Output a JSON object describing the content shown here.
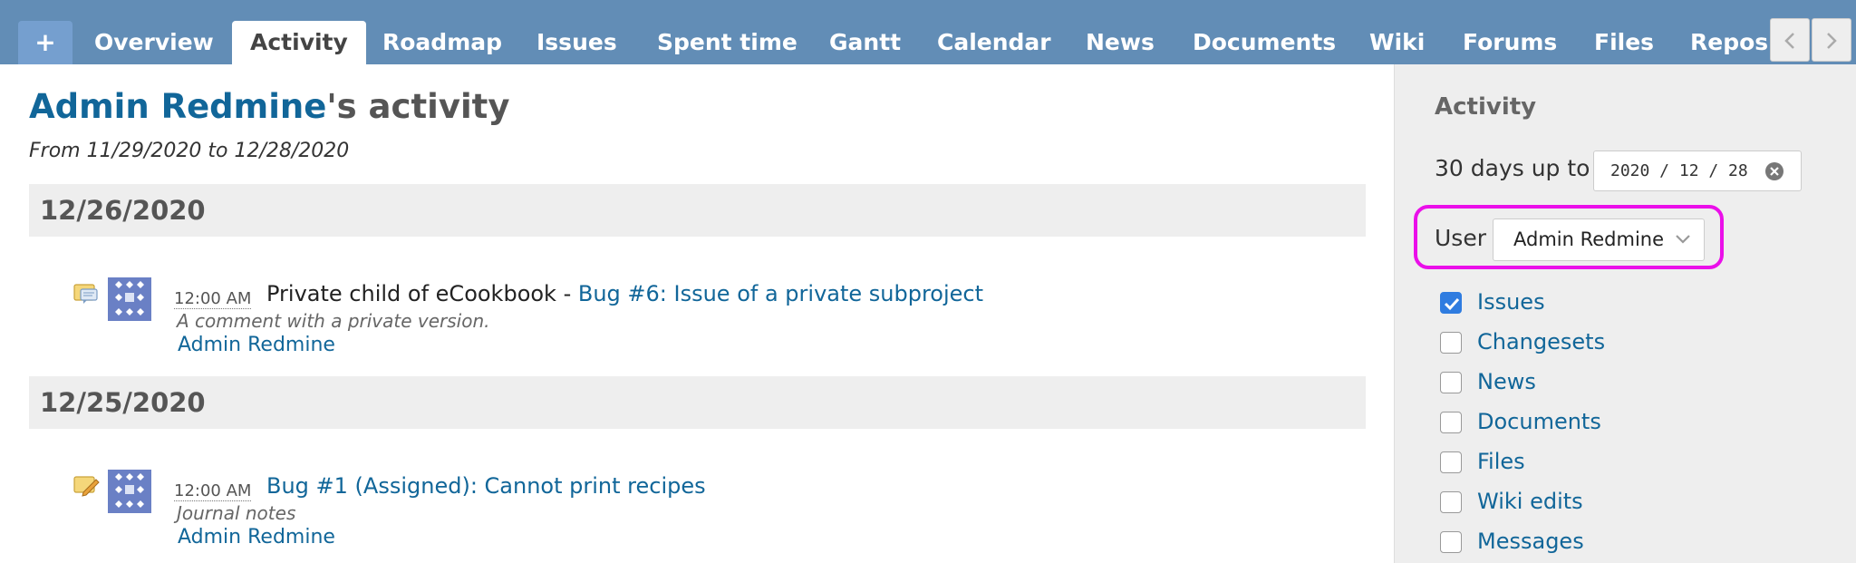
{
  "tabs": {
    "plus_label": "+",
    "items": [
      {
        "label": "Overview",
        "selected": false
      },
      {
        "label": "Activity",
        "selected": true
      },
      {
        "label": "Roadmap",
        "selected": false
      },
      {
        "label": "Issues",
        "selected": false
      },
      {
        "label": "Spent time",
        "selected": false
      },
      {
        "label": "Gantt",
        "selected": false
      },
      {
        "label": "Calendar",
        "selected": false
      },
      {
        "label": "News",
        "selected": false
      },
      {
        "label": "Documents",
        "selected": false
      },
      {
        "label": "Wiki",
        "selected": false
      },
      {
        "label": "Forums",
        "selected": false
      },
      {
        "label": "Files",
        "selected": false
      },
      {
        "label": "Repository",
        "selected": false
      }
    ]
  },
  "page": {
    "title_user": "Admin Redmine",
    "title_suffix": "'s activity",
    "subtitle": "From 11/29/2020 to 12/28/2020"
  },
  "days": [
    {
      "date": "12/26/2020",
      "entries": [
        {
          "icon": "issue-note-icon",
          "time": "12:00 AM",
          "project": "Private child of eCookbook - ",
          "link": "Bug #6: Issue of a private subproject",
          "description": "A comment with a private version.",
          "author": "Admin Redmine"
        }
      ]
    },
    {
      "date": "12/25/2020",
      "entries": [
        {
          "icon": "issue-edit-icon",
          "time": "12:00 AM",
          "project": "",
          "link": "Bug #1 (Assigned): Cannot print recipes",
          "description": "Journal notes",
          "author": "Admin Redmine"
        }
      ]
    }
  ],
  "sidebar": {
    "title": "Activity",
    "days_label": "30 days up to",
    "date_value": "2020 / 12 / 28",
    "user_label": "User",
    "user_value": "Admin Redmine",
    "filters": [
      {
        "label": "Issues",
        "checked": true
      },
      {
        "label": "Changesets",
        "checked": false
      },
      {
        "label": "News",
        "checked": false
      },
      {
        "label": "Documents",
        "checked": false
      },
      {
        "label": "Files",
        "checked": false
      },
      {
        "label": "Wiki edits",
        "checked": false
      },
      {
        "label": "Messages",
        "checked": false
      }
    ]
  },
  "colors": {
    "tabbar": "#628db6",
    "link": "#116699",
    "highlight": "#ea0fe9",
    "checkbox_checked": "#2f7ce0"
  }
}
